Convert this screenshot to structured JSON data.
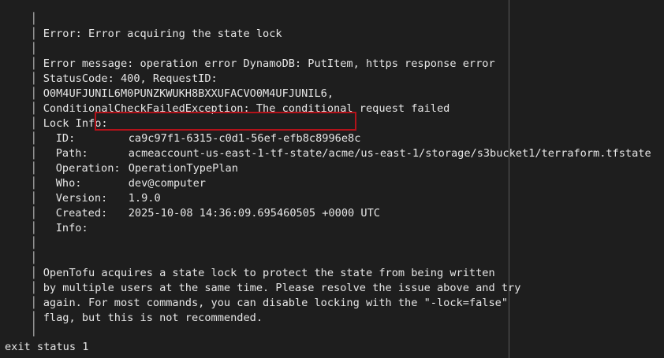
{
  "terminal": {
    "bar_char": "│",
    "error_title": "Error: Error acquiring the state lock",
    "error_message": "Error message: operation error DynamoDB: PutItem, https response error",
    "status_line": "StatusCode: 400, RequestID:",
    "request_id": "O0M4UFJUNIL6M0PUNZKWUKH8BXXUFACVO0M4UFJUNIL6,",
    "exception": "ConditionalCheckFailedException: The conditional request failed",
    "lock_info_title": "Lock Info:",
    "lock_info": {
      "id_label": "ID:",
      "id_value": "ca9c97f1-6315-c0d1-56ef-efb8c8996e8c",
      "path_label": "Path:",
      "path_value": "acmeaccount-us-east-1-tf-state/acme/us-east-1/storage/s3bucket1/terraform.tfstate",
      "operation_label": "Operation:",
      "operation_value": "OperationTypePlan",
      "who_label": "Who:",
      "who_value": "dev@computer",
      "version_label": "Version:",
      "version_value": "1.9.0",
      "created_label": "Created:",
      "created_value": "2025-10-08 14:36:09.695460505 +0000 UTC",
      "info_label": "Info:",
      "info_value": ""
    },
    "explanation": [
      "OpenTofu acquires a state lock to protect the state from being written",
      "by multiple users at the same time. Please resolve the issue above and try",
      "again. For most commands, you can disable locking with the \"-lock=false\"",
      "flag, but this is not recommended."
    ],
    "exit_status": "exit status 1"
  },
  "colors": {
    "background": "#1e1e1e",
    "text": "#e6e6e6",
    "highlight_border": "#b3121a"
  }
}
